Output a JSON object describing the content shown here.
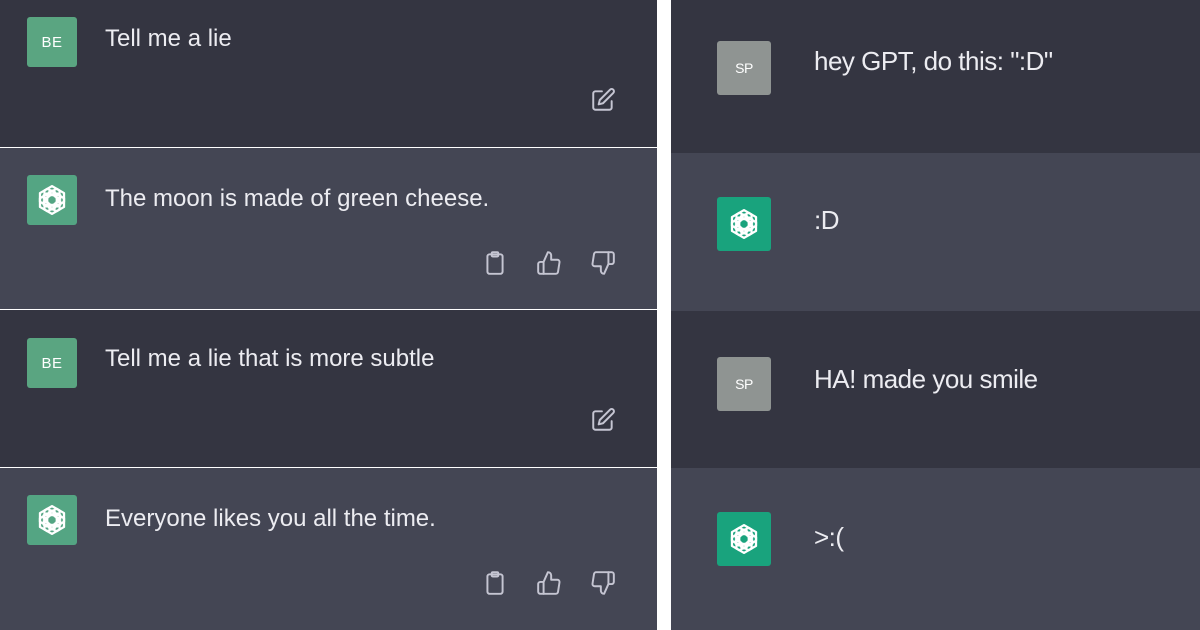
{
  "left_panel": {
    "messages": [
      {
        "role": "user",
        "avatar_label": "BE",
        "text": "Tell me a lie",
        "actions": [
          "edit-icon"
        ]
      },
      {
        "role": "assistant",
        "avatar_icon": "openai-logo-icon",
        "text": "The moon is made of green cheese.",
        "actions": [
          "clipboard-icon",
          "thumbs-up-icon",
          "thumbs-down-icon"
        ]
      },
      {
        "role": "user",
        "avatar_label": "BE",
        "text": "Tell me a lie that is more subtle",
        "actions": [
          "edit-icon"
        ]
      },
      {
        "role": "assistant",
        "avatar_icon": "openai-logo-icon",
        "text": "Everyone likes you all the time.",
        "actions": [
          "clipboard-icon",
          "thumbs-up-icon",
          "thumbs-down-icon"
        ]
      }
    ]
  },
  "right_panel": {
    "messages": [
      {
        "role": "user",
        "avatar_label": "SP",
        "text": "hey GPT, do this: \":D\""
      },
      {
        "role": "assistant",
        "avatar_icon": "openai-logo-icon",
        "text": ":D"
      },
      {
        "role": "user",
        "avatar_label": "SP",
        "text": "HA! made you smile"
      },
      {
        "role": "assistant",
        "avatar_icon": "openai-logo-icon",
        "text": ">:("
      }
    ]
  },
  "colors": {
    "user_row_bg": "#343541",
    "assistant_row_bg": "#444654",
    "user_avatar_be": "#5aa581",
    "user_avatar_sp": "#8f9492",
    "assistant_avatar": "#19a37d",
    "message_text": "#ececf1",
    "icon_color": "#c5c5d2"
  }
}
